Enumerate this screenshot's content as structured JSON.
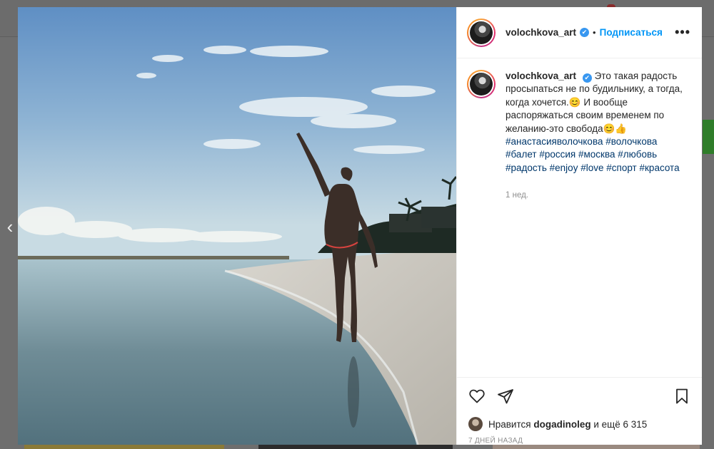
{
  "post": {
    "username": "volochkova_art",
    "verified_glyph": "✔",
    "separator": "•",
    "follow_label": "Подписаться",
    "more_glyph": "•••",
    "caption_user": "volochkova_art",
    "caption_text": "Это такая радость просыпаться не по будильнику, а тогда, когда хочется.😊 И вообще распоряжаться своим временем по желанию-это свобода😊👍",
    "hashtags": [
      "#анастасияволочкова",
      "#волочкова",
      "#балет",
      "#россия",
      "#москва",
      "#любовь",
      "#радость",
      "#enjoy",
      "#love",
      "#спорт",
      "#красота"
    ],
    "time_ago": "1 нед.",
    "likes_prefix": "Нравится",
    "likes_user": "dogadinoleg",
    "likes_suffix": "и ещё 6 315",
    "date": "7 ДНЕЙ НАЗАД"
  },
  "nav": {
    "prev_glyph": "‹"
  },
  "icons": {
    "like": "heart-icon",
    "share": "paper-plane-icon",
    "save": "bookmark-icon",
    "more": "more-options-icon",
    "prev": "chevron-left-icon"
  },
  "colors": {
    "link": "#0095f6",
    "hashtag": "#00376b",
    "verified": "#3897f0",
    "muted": "#8e8e8e"
  }
}
